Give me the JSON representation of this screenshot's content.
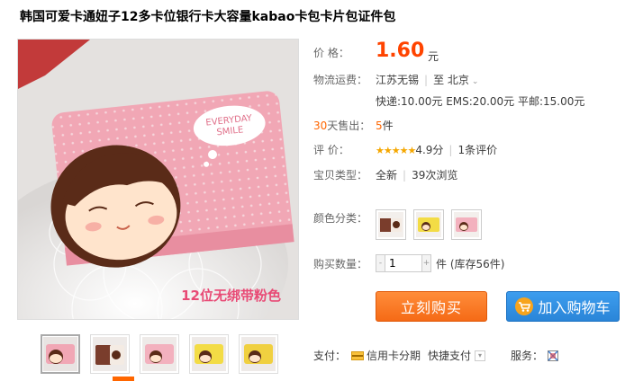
{
  "product": {
    "title": "韩国可爱卡通妞子12多卡位银行卡大容量kabao卡包卡片包证件包",
    "image_caption": "12位无绑带粉色",
    "bubble_text_1": "EVERYDAY",
    "bubble_text_2": "SMILE"
  },
  "price": {
    "label": "价    格：",
    "value": "1.60",
    "unit": "元"
  },
  "shipping": {
    "label": "物流运费：",
    "from": "江苏无锡",
    "to_prefix": "至",
    "to": "北京",
    "fees": "快递:10.00元 EMS:20.00元 平邮:15.00元"
  },
  "sales": {
    "label_prefix": "30",
    "label_suffix": "天售出：",
    "count": "5",
    "unit": "件"
  },
  "rating": {
    "label": "评    价：",
    "stars": "★★★★★",
    "score": "4.9分",
    "reviews": "1条评价"
  },
  "type": {
    "label": "宝贝类型：",
    "condition": "全新",
    "views": "39次浏览"
  },
  "color": {
    "label": "颜色分类："
  },
  "quantity": {
    "label": "购买数量：",
    "minus": "-",
    "value": "1",
    "plus": "+",
    "unit": "件",
    "stock": "(库存56件)"
  },
  "buttons": {
    "buy_now": "立刻购买",
    "add_to_cart": "加入购物车"
  },
  "payment": {
    "label": "支付：",
    "credit": "信用卡分期",
    "quick": "快捷支付",
    "service_label": "服务："
  },
  "colors": {
    "price": "#ff4400",
    "accent": "#ff6600",
    "buy": "#f56a16",
    "cart": "#2a85d8"
  }
}
